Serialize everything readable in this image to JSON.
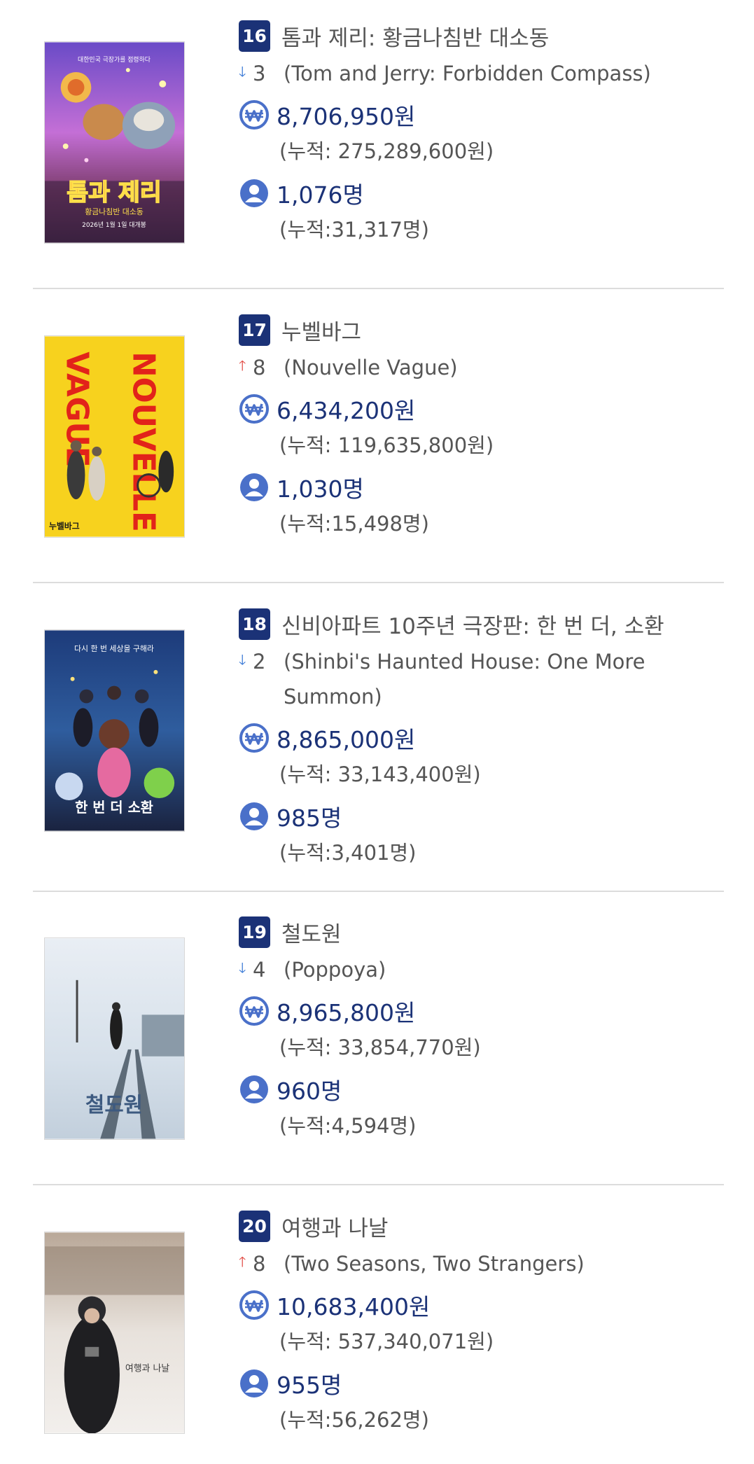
{
  "colors": {
    "rank_bg": "#1b3277",
    "value_text": "#1b3277",
    "down_arrow": "#2f72d4",
    "up_arrow": "#e0453e",
    "divider": "#dcdcdc"
  },
  "icons": {
    "revenue": "won-coin-icon",
    "audience": "person-circle-icon",
    "down": "arrow-down-icon",
    "up": "arrow-up-icon"
  },
  "movies": [
    {
      "rank": "16",
      "title_ko": "톰과 제리: 황금나침반 대소동",
      "change_dir": "down",
      "change": "3",
      "title_en": "(Tom and Jerry: Forbidden Compass)",
      "revenue": "8,706,950원",
      "revenue_cum": "(누적: 275,289,600원)",
      "audience": "1,076명",
      "audience_cum": "(누적:31,317명)",
      "poster": {
        "title": "톰과 제리",
        "subtitle": "황금나침반 대소동",
        "tagline": "대한민국 극장가를 점령하다",
        "date": "2026년 1월 1일 대개봉"
      }
    },
    {
      "rank": "17",
      "title_ko": "누벨바그",
      "change_dir": "up",
      "change": "8",
      "title_en": "(Nouvelle Vague)",
      "revenue": "6,434,200원",
      "revenue_cum": "(누적: 119,635,800원)",
      "audience": "1,030명",
      "audience_cum": "(누적:15,498명)",
      "poster": {
        "title": "NOUVELLE",
        "subtitle": "VAGUE",
        "tagline": "누벨바그",
        "date": ""
      }
    },
    {
      "rank": "18",
      "title_ko": "신비아파트 10주년 극장판: 한 번 더, 소환",
      "change_dir": "down",
      "change": "2",
      "title_en": "(Shinbi's Haunted House: One More Summon)",
      "revenue": "8,865,000원",
      "revenue_cum": "(누적: 33,143,400원)",
      "audience": "985명",
      "audience_cum": "(누적:3,401명)",
      "poster": {
        "title": "한 번 더 소환",
        "subtitle": "",
        "tagline": "다시 한 번 세상을 구해라",
        "date": ""
      }
    },
    {
      "rank": "19",
      "title_ko": "철도원",
      "change_dir": "down",
      "change": "4",
      "title_en": "(Poppoya)",
      "revenue": "8,965,800원",
      "revenue_cum": "(누적: 33,854,770원)",
      "audience": "960명",
      "audience_cum": "(누적:4,594명)",
      "poster": {
        "title": "철도원",
        "subtitle": "",
        "tagline": "",
        "date": ""
      }
    },
    {
      "rank": "20",
      "title_ko": "여행과 나날",
      "change_dir": "up",
      "change": "8",
      "title_en": "(Two Seasons, Two Strangers)",
      "revenue": "10,683,400원",
      "revenue_cum": "(누적: 537,340,071원)",
      "audience": "955명",
      "audience_cum": "(누적:56,262명)",
      "poster": {
        "title": "여행과 나날",
        "subtitle": "",
        "tagline": "",
        "date": ""
      }
    }
  ]
}
